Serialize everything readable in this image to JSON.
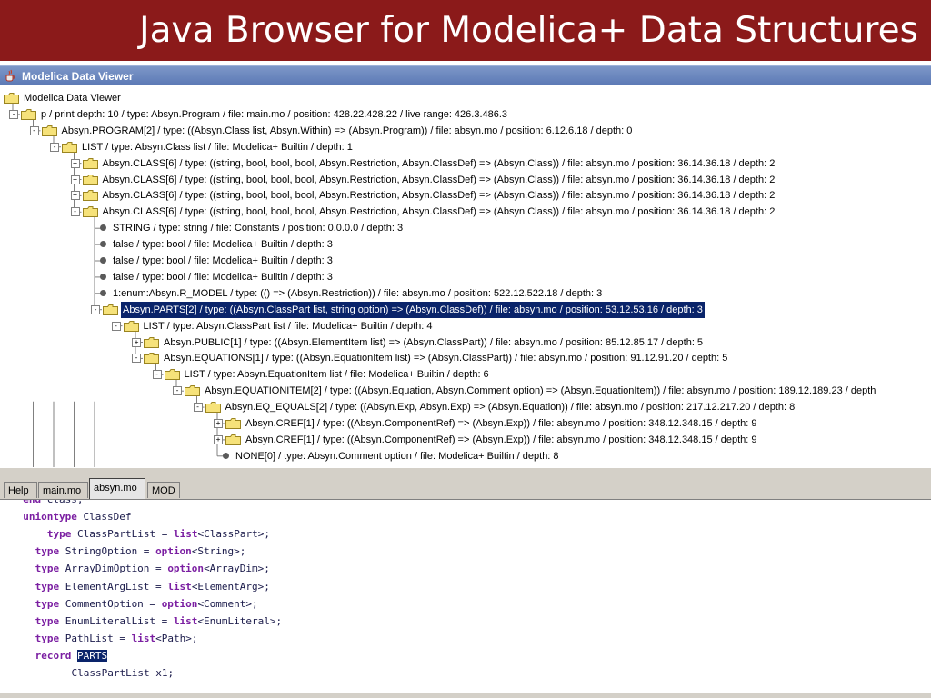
{
  "slide": {
    "title": "Java Browser for Modelica+ Data Structures"
  },
  "window": {
    "title": "Modelica Data Viewer"
  },
  "tree": {
    "nodes": [
      {
        "text": "Modelica Data Viewer",
        "kind": "folder",
        "depth": 0,
        "toggle": ""
      },
      {
        "text": "p / print depth: 10 / type: Absyn.Program / file: main.mo / position: 428.22.428.22 / live range: 426.3.486.3",
        "kind": "folder",
        "depth": 0,
        "toggle": "-"
      },
      {
        "text": "Absyn.PROGRAM[2] / type: ((Absyn.Class list, Absyn.Within) => (Absyn.Program)) / file: absyn.mo / position: 6.12.6.18 / depth: 0",
        "kind": "folder",
        "depth": 1,
        "toggle": "-"
      },
      {
        "text": "LIST / type: Absyn.Class list / file: Modelica+ Builtin / depth: 1",
        "kind": "folder",
        "depth": 2,
        "toggle": "-"
      },
      {
        "text": "Absyn.CLASS[6] / type: ((string, bool, bool, bool, Absyn.Restriction, Absyn.ClassDef) => (Absyn.Class)) / file: absyn.mo / position: 36.14.36.18 / depth: 2",
        "kind": "folder",
        "depth": 3,
        "toggle": "+"
      },
      {
        "text": "Absyn.CLASS[6] / type: ((string, bool, bool, bool, Absyn.Restriction, Absyn.ClassDef) => (Absyn.Class)) / file: absyn.mo / position: 36.14.36.18 / depth: 2",
        "kind": "folder",
        "depth": 3,
        "toggle": "+"
      },
      {
        "text": "Absyn.CLASS[6] / type: ((string, bool, bool, bool, Absyn.Restriction, Absyn.ClassDef) => (Absyn.Class)) / file: absyn.mo / position: 36.14.36.18 / depth: 2",
        "kind": "folder",
        "depth": 3,
        "toggle": "+"
      },
      {
        "text": "Absyn.CLASS[6] / type: ((string, bool, bool, bool, Absyn.Restriction, Absyn.ClassDef) => (Absyn.Class)) / file: absyn.mo / position: 36.14.36.18 / depth: 2",
        "kind": "folder",
        "depth": 3,
        "toggle": "-"
      },
      {
        "text": "STRING / type: string / file: Constants / position: 0.0.0.0 / depth: 3",
        "kind": "leaf",
        "depth": 4,
        "toggle": ""
      },
      {
        "text": "false / type: bool / file: Modelica+ Builtin / depth: 3",
        "kind": "leaf",
        "depth": 4,
        "toggle": ""
      },
      {
        "text": "false / type: bool / file: Modelica+ Builtin / depth: 3",
        "kind": "leaf",
        "depth": 4,
        "toggle": ""
      },
      {
        "text": "false / type: bool / file: Modelica+ Builtin / depth: 3",
        "kind": "leaf",
        "depth": 4,
        "toggle": ""
      },
      {
        "text": "1:enum:Absyn.R_MODEL / type: (() => (Absyn.Restriction)) / file: absyn.mo / position: 522.12.522.18 / depth: 3",
        "kind": "leaf",
        "depth": 4,
        "toggle": ""
      },
      {
        "text": "Absyn.PARTS[2] / type: ((Absyn.ClassPart list, string option) => (Absyn.ClassDef)) / file: absyn.mo / position: 53.12.53.16 / depth: 3",
        "kind": "folder",
        "depth": 4,
        "toggle": "-",
        "selected": true
      },
      {
        "text": "LIST / type: Absyn.ClassPart list / file: Modelica+ Builtin / depth: 4",
        "kind": "folder",
        "depth": 5,
        "toggle": "-"
      },
      {
        "text": "Absyn.PUBLIC[1] / type: ((Absyn.ElementItem list) => (Absyn.ClassPart)) / file: absyn.mo / position: 85.12.85.17 / depth: 5",
        "kind": "folder",
        "depth": 6,
        "toggle": "+"
      },
      {
        "text": "Absyn.EQUATIONS[1] / type: ((Absyn.EquationItem list) => (Absyn.ClassPart)) / file: absyn.mo / position: 91.12.91.20 / depth: 5",
        "kind": "folder",
        "depth": 6,
        "toggle": "-"
      },
      {
        "text": "LIST / type: Absyn.EquationItem list / file: Modelica+ Builtin / depth: 6",
        "kind": "folder",
        "depth": 7,
        "toggle": "-"
      },
      {
        "text": "Absyn.EQUATIONITEM[2] / type: ((Absyn.Equation, Absyn.Comment option) => (Absyn.EquationItem)) / file: absyn.mo / position: 189.12.189.23 / depth",
        "kind": "folder",
        "depth": 8,
        "toggle": "-"
      },
      {
        "text": "Absyn.EQ_EQUALS[2] / type: ((Absyn.Exp, Absyn.Exp) => (Absyn.Equation)) / file: absyn.mo / position: 217.12.217.20 / depth: 8",
        "kind": "folder",
        "depth": 9,
        "toggle": "-"
      },
      {
        "text": "Absyn.CREF[1] / type: ((Absyn.ComponentRef) => (Absyn.Exp)) / file: absyn.mo / position: 348.12.348.15 / depth: 9",
        "kind": "folder",
        "depth": 10,
        "toggle": "+"
      },
      {
        "text": "Absyn.CREF[1] / type: ((Absyn.ComponentRef) => (Absyn.Exp)) / file: absyn.mo / position: 348.12.348.15 / depth: 9",
        "kind": "folder",
        "depth": 10,
        "toggle": "+"
      },
      {
        "text": "NONE[0] / type: Absyn.Comment option / file: Modelica+ Builtin / depth: 8",
        "kind": "leaf",
        "depth": 10,
        "toggle": ""
      }
    ]
  },
  "tabs": [
    {
      "label": "Help",
      "active": false
    },
    {
      "label": "main.mo",
      "active": false
    },
    {
      "label": "absyn.mo",
      "active": true
    },
    {
      "label": "MOD",
      "active": false
    }
  ],
  "code": {
    "lines": [
      {
        "indent": 2,
        "parts": [
          {
            "t": "end ",
            "kw": true
          },
          {
            "t": "class;",
            "kw": false
          }
        ]
      },
      {
        "indent": 2,
        "parts": [
          {
            "t": "uniontype",
            "kw": true
          },
          {
            "t": " ClassDef",
            "kw": false
          }
        ]
      },
      {
        "indent": 6,
        "parts": [
          {
            "t": "type",
            "kw": true
          },
          {
            "t": " ClassPartList = ",
            "kw": false
          },
          {
            "t": "list",
            "kw": true
          },
          {
            "t": "<ClassPart>;",
            "kw": false
          }
        ]
      },
      {
        "indent": 4,
        "parts": [
          {
            "t": "type",
            "kw": true
          },
          {
            "t": " StringOption = ",
            "kw": false
          },
          {
            "t": "option",
            "kw": true
          },
          {
            "t": "<String>;",
            "kw": false
          }
        ]
      },
      {
        "indent": 4,
        "parts": [
          {
            "t": "type",
            "kw": true
          },
          {
            "t": " ArrayDimOption = ",
            "kw": false
          },
          {
            "t": "option",
            "kw": true
          },
          {
            "t": "<ArrayDim>;",
            "kw": false
          }
        ]
      },
      {
        "indent": 4,
        "parts": [
          {
            "t": "type",
            "kw": true
          },
          {
            "t": " ElementArgList = ",
            "kw": false
          },
          {
            "t": "list",
            "kw": true
          },
          {
            "t": "<ElementArg>;",
            "kw": false
          }
        ]
      },
      {
        "indent": 4,
        "parts": [
          {
            "t": "type",
            "kw": true
          },
          {
            "t": " CommentOption = ",
            "kw": false
          },
          {
            "t": "option",
            "kw": true
          },
          {
            "t": "<Comment>;",
            "kw": false
          }
        ]
      },
      {
        "indent": 4,
        "parts": [
          {
            "t": "type",
            "kw": true
          },
          {
            "t": " EnumLiteralList = ",
            "kw": false
          },
          {
            "t": "list",
            "kw": true
          },
          {
            "t": "<EnumLiteral>;",
            "kw": false
          }
        ]
      },
      {
        "indent": 4,
        "parts": [
          {
            "t": "type",
            "kw": true
          },
          {
            "t": " PathList = ",
            "kw": false
          },
          {
            "t": "list",
            "kw": true
          },
          {
            "t": "<Path>;",
            "kw": false
          }
        ]
      },
      {
        "indent": 4,
        "parts": [
          {
            "t": "record",
            "kw": true
          },
          {
            "t": " ",
            "kw": false
          },
          {
            "t": "PARTS",
            "kw": false,
            "sel": true
          }
        ]
      },
      {
        "indent": 10,
        "parts": [
          {
            "t": "ClassPartList x1;",
            "kw": false
          }
        ]
      }
    ]
  }
}
